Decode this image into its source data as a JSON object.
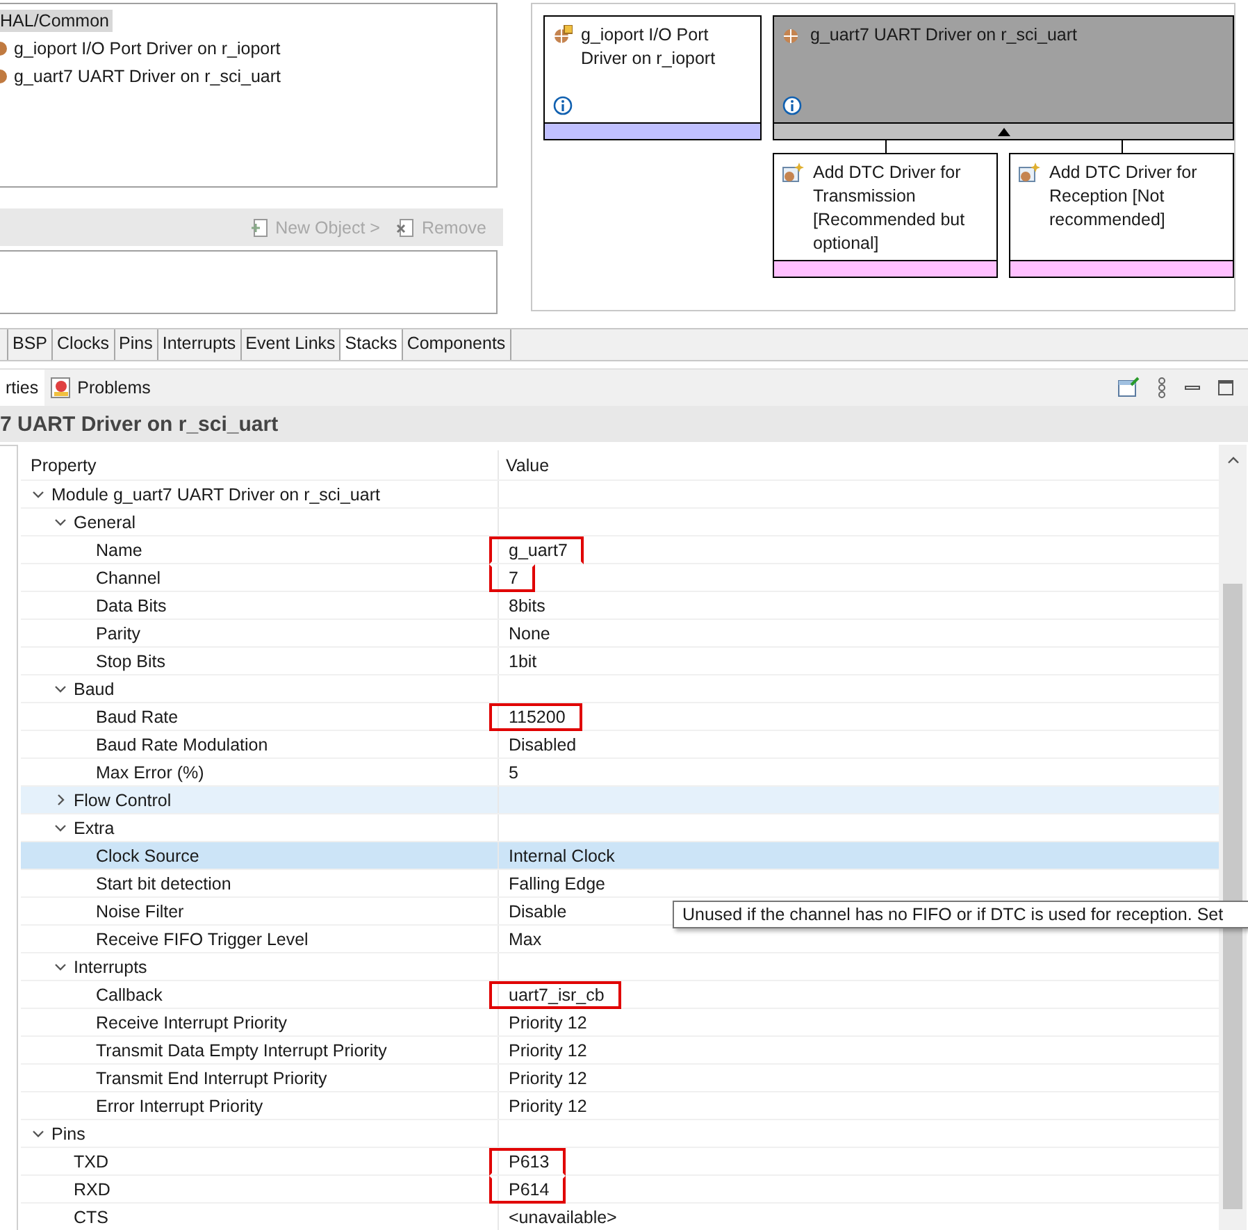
{
  "tree_panel": {
    "items": [
      {
        "label": "HAL/Common",
        "selected": true,
        "children": [
          {
            "label": "g_ioport I/O Port Driver on r_ioport",
            "selected": false
          },
          {
            "label": "g_uart7 UART Driver on r_sci_uart",
            "selected": false
          }
        ]
      }
    ]
  },
  "toolbar": {
    "buttons": [
      {
        "label": "New Object >",
        "disabled": true,
        "kind": "new"
      },
      {
        "label": "Remove",
        "disabled": true,
        "kind": "remove"
      }
    ]
  },
  "stack_diagram": {
    "modules": [
      {
        "title": "g_ioport I/O Port Driver on r_ioport",
        "selected": false,
        "color": "#c0c0ff",
        "kind": "port"
      },
      {
        "title": "g_uart7 UART Driver on r_sci_uart",
        "selected": true,
        "color": "#c0c0c0",
        "kind": "uart",
        "expanded": true,
        "children": [
          {
            "title": "Add DTC Driver for Transmission [Recommended but optional]",
            "color": "#ffc0ff"
          },
          {
            "title": "Add DTC Driver for Reception [Not recommended]",
            "color": "#ffc0ff"
          }
        ]
      }
    ]
  },
  "editor_tabs": [
    {
      "label": "BSP",
      "selected": false
    },
    {
      "label": "Clocks",
      "selected": false
    },
    {
      "label": "Pins",
      "selected": false
    },
    {
      "label": "Interrupts",
      "selected": false
    },
    {
      "label": "Event Links",
      "selected": false
    },
    {
      "label": "Stacks",
      "selected": true
    },
    {
      "label": "Components",
      "selected": false
    }
  ],
  "view_tabs": [
    {
      "label": "rties",
      "selected": true,
      "kind": "properties"
    },
    {
      "label": "Problems",
      "selected": false,
      "kind": "problems"
    }
  ],
  "properties": {
    "title": "7 UART Driver on r_sci_uart",
    "columns": [
      "Property",
      "Value"
    ],
    "tooltip": "Unused if the channel has no FIFO or if DTC is used for reception.  Set",
    "rows": [
      {
        "property": "Module g_uart7 UART Driver on r_sci_uart",
        "expanded": true,
        "selected": false,
        "hovered": false,
        "children": [
          {
            "property": "General",
            "expanded": true,
            "selected": false,
            "hovered": false,
            "children": [
              {
                "property": "Name",
                "value": "g_uart7",
                "selected": false,
                "hovered": false,
                "annotated": true
              },
              {
                "property": "Channel",
                "value": "7",
                "selected": false,
                "hovered": false,
                "annotated": true
              },
              {
                "property": "Data Bits",
                "value": "8bits",
                "selected": false,
                "hovered": false,
                "annotated": false
              },
              {
                "property": "Parity",
                "value": "None",
                "selected": false,
                "hovered": false,
                "annotated": false
              },
              {
                "property": "Stop Bits",
                "value": "1bit",
                "selected": false,
                "hovered": false,
                "annotated": false
              }
            ]
          },
          {
            "property": "Baud",
            "expanded": true,
            "selected": false,
            "hovered": false,
            "children": [
              {
                "property": "Baud Rate",
                "value": "115200",
                "selected": false,
                "hovered": false,
                "annotated": true
              },
              {
                "property": "Baud Rate Modulation",
                "value": "Disabled",
                "selected": false,
                "hovered": false,
                "annotated": false
              },
              {
                "property": "Max Error (%)",
                "value": "5",
                "selected": false,
                "hovered": false,
                "annotated": false
              }
            ]
          },
          {
            "property": "Flow Control",
            "expanded": false,
            "selected": false,
            "hovered": true
          },
          {
            "property": "Extra",
            "expanded": true,
            "selected": false,
            "hovered": false,
            "children": [
              {
                "property": "Clock Source",
                "value": "Internal Clock",
                "selected": true,
                "hovered": false,
                "annotated": false
              },
              {
                "property": "Start bit detection",
                "value": "Falling Edge",
                "selected": false,
                "hovered": false,
                "annotated": false
              },
              {
                "property": "Noise Filter",
                "value": "Disable",
                "selected": false,
                "hovered": false,
                "annotated": false
              },
              {
                "property": "Receive FIFO Trigger Level",
                "value": "Max",
                "selected": false,
                "hovered": false,
                "annotated": false
              }
            ]
          },
          {
            "property": "Interrupts",
            "expanded": true,
            "selected": false,
            "hovered": false,
            "children": [
              {
                "property": "Callback",
                "value": "uart7_isr_cb",
                "selected": false,
                "hovered": false,
                "annotated": true
              },
              {
                "property": "Receive Interrupt Priority",
                "value": "Priority 12",
                "selected": false,
                "hovered": false,
                "annotated": false
              },
              {
                "property": "Transmit Data Empty Interrupt Priority",
                "value": "Priority 12",
                "selected": false,
                "hovered": false,
                "annotated": false
              },
              {
                "property": "Transmit End Interrupt Priority",
                "value": "Priority 12",
                "selected": false,
                "hovered": false,
                "annotated": false
              },
              {
                "property": "Error Interrupt Priority",
                "value": "Priority 12",
                "selected": false,
                "hovered": false,
                "annotated": false
              }
            ]
          }
        ]
      },
      {
        "property": "Pins",
        "expanded": true,
        "selected": false,
        "hovered": false,
        "children": [
          {
            "property": "TXD",
            "value": "P613",
            "selected": false,
            "hovered": false,
            "annotated": true
          },
          {
            "property": "RXD",
            "value": "P614",
            "selected": false,
            "hovered": false,
            "annotated": true
          },
          {
            "property": "CTS",
            "value": "<unavailable>",
            "selected": false,
            "hovered": false,
            "annotated": false
          }
        ]
      }
    ]
  }
}
